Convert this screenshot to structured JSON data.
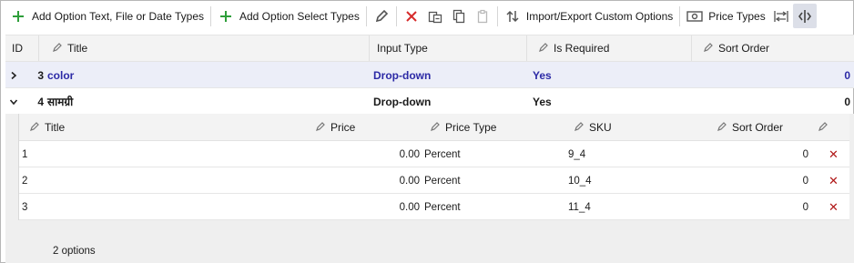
{
  "toolbar": {
    "add_option_types": "Add Option Text, File or Date Types",
    "add_select_types": "Add Option Select Types",
    "import_export": "Import/Export Custom Options",
    "price_types": "Price Types"
  },
  "grid": {
    "columns": {
      "id": "ID",
      "title": "Title",
      "input_type": "Input Type",
      "is_required": "Is Required",
      "sort_order": "Sort Order"
    },
    "rows": [
      {
        "id": "3",
        "title": "color",
        "input_type": "Drop-down",
        "is_required": "Yes",
        "sort_order": "0",
        "expanded": false
      },
      {
        "id": "4",
        "title": "सामग्री",
        "input_type": "Drop-down",
        "is_required": "Yes",
        "sort_order": "0",
        "expanded": true
      }
    ]
  },
  "detail": {
    "columns": {
      "title": "Title",
      "price": "Price",
      "price_type": "Price Type",
      "sku": "SKU",
      "sort_order": "Sort Order"
    },
    "rows": [
      {
        "title": "1",
        "price": "0.00",
        "price_type": "Percent",
        "sku": "9_4",
        "sort_order": "0"
      },
      {
        "title": "2",
        "price": "0.00",
        "price_type": "Percent",
        "sku": "10_4",
        "sort_order": "0"
      },
      {
        "title": "3",
        "price": "0.00",
        "price_type": "Percent",
        "sku": "11_4",
        "sort_order": "0"
      }
    ],
    "footer": "2 options"
  },
  "colors": {
    "selected_text": "#2c2aa6",
    "selected_bg": "#eceef8",
    "add_icon": "#2e9e3a",
    "delete_icon": "#d62b2b"
  }
}
